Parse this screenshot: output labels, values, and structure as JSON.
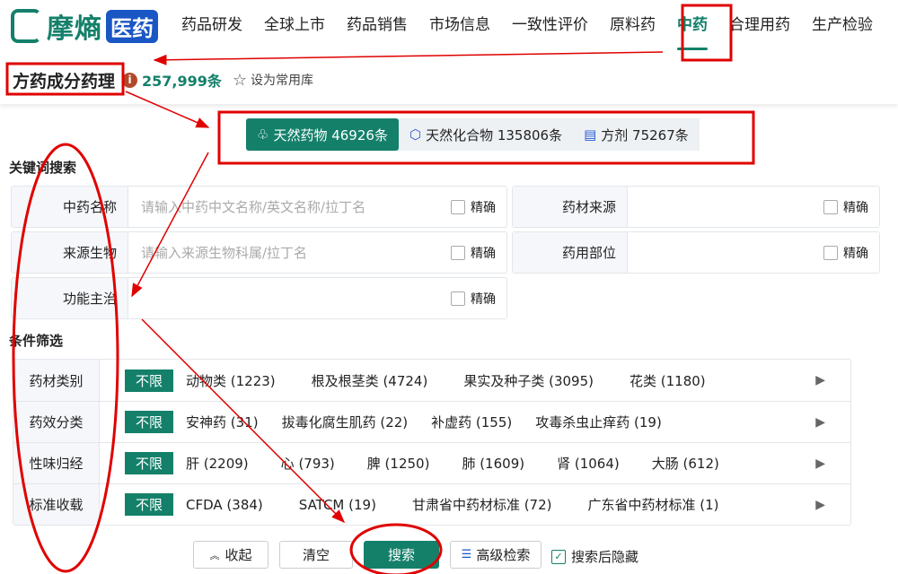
{
  "brand": {
    "name": "摩熵",
    "badge": "医药"
  },
  "nav": {
    "items": [
      "药品研发",
      "全球上市",
      "药品销售",
      "市场信息",
      "一致性评价",
      "原料药",
      "中药",
      "合理用药",
      "生产检验"
    ],
    "active": "中药"
  },
  "header": {
    "title": "方药成分药理",
    "count": "257,999条",
    "favorite": "设为常用库"
  },
  "tabs": [
    {
      "label": "天然药物 46926条",
      "icon": "herb-icon"
    },
    {
      "label": "天然化合物 135806条",
      "icon": "cube-icon"
    },
    {
      "label": "方剂 75267条",
      "icon": "document-icon"
    }
  ],
  "keyword": {
    "title": "关键词搜索",
    "exact": "精确",
    "fields": [
      {
        "label": "中药名称",
        "placeholder": "请输入中药中文名称/英文名称/拉丁名"
      },
      {
        "label": "药材来源",
        "placeholder": ""
      },
      {
        "label": "来源生物",
        "placeholder": "请输入来源生物科属/拉丁名"
      },
      {
        "label": "药用部位",
        "placeholder": ""
      },
      {
        "label": "功能主治",
        "placeholder": ""
      }
    ]
  },
  "filters": {
    "title": "条件筛选",
    "unlimited": "不限",
    "rows": [
      {
        "label": "药材类别",
        "options": [
          "动物类 (1223)",
          "根及根茎类 (4724)",
          "果实及种子类 (3095)",
          "花类 (1180)"
        ]
      },
      {
        "label": "药效分类",
        "options": [
          "安神药 (31)",
          "拔毒化腐生肌药 (22)",
          "补虚药 (155)",
          "攻毒杀虫止痒药 (19)"
        ]
      },
      {
        "label": "性味归经",
        "options": [
          "肝 (2209)",
          "心 (793)",
          "脾 (1250)",
          "肺 (1609)",
          "肾 (1064)",
          "大肠 (612)"
        ]
      },
      {
        "label": "标准收载",
        "options": [
          "CFDA (384)",
          "SATCM (19)",
          "甘肃省中药材标准 (72)",
          "广东省中药材标准 (1)"
        ]
      }
    ]
  },
  "actions": {
    "collapse": "收起",
    "clear": "清空",
    "search": "搜索",
    "advanced": "高级检索",
    "hide_after": "搜索后隐藏"
  },
  "colors": {
    "brand": "#14806a",
    "annotation": "#e00000"
  }
}
